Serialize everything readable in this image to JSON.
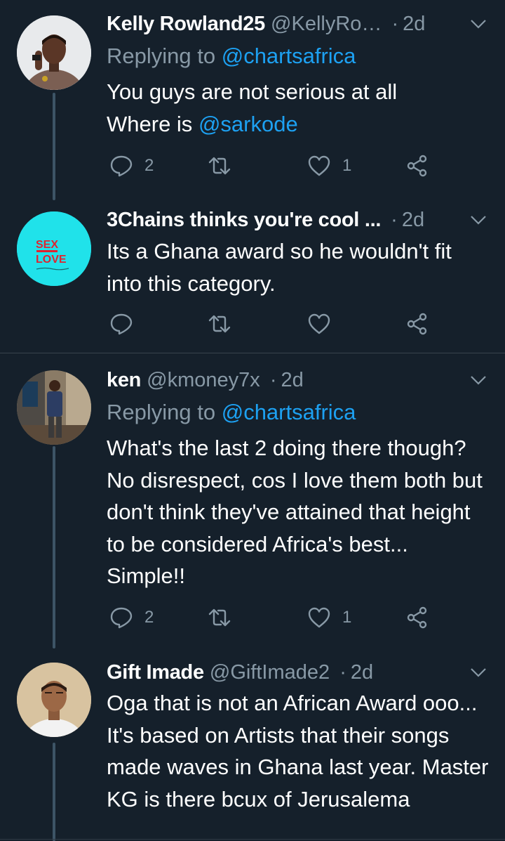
{
  "tweets": [
    {
      "name": "Kelly Rowland25",
      "handle": "@KellyRo…",
      "time": "2d",
      "replying_label": "Replying to",
      "replying_to": "@chartsafrica",
      "line1": "You guys are not serious at all",
      "line2_prefix": "Where is",
      "line2_link": "@sarkode",
      "replies": "2",
      "retweets": "",
      "likes": "1"
    },
    {
      "name": "3Chains thinks you're cool ...",
      "time": "2d",
      "text": "Its a Ghana award so he wouldn't fit into this category.",
      "avatar_text_top": "SEX",
      "avatar_text_bottom": "LOVE",
      "replies": "",
      "retweets": "",
      "likes": ""
    },
    {
      "name": "ken",
      "handle": "@kmoney7x",
      "time": "2d",
      "replying_label": "Replying to",
      "replying_to": "@chartsafrica",
      "text": "What's the last 2 doing there though? No disrespect, cos I love them both but don't think they've attained that height to be considered Africa's best... Simple!!",
      "replies": "2",
      "retweets": "",
      "likes": "1"
    },
    {
      "name": "Gift Imade",
      "handle": "@GiftImade2",
      "time": "2d",
      "text": "Oga that is not an African Award ooo... It's based on Artists that their songs made waves in Ghana last year. Master KG is there bcux of Jerusalema"
    }
  ],
  "icons": {
    "reply": "reply-icon",
    "retweet": "retweet-icon",
    "like": "heart-icon",
    "share": "share-icon",
    "menu": "chevron-down-icon"
  },
  "colors": {
    "background": "#15202b",
    "secondary_text": "#8899a6",
    "link": "#1da1f2",
    "divider": "#38444d",
    "thread_line": "#3d5466"
  }
}
